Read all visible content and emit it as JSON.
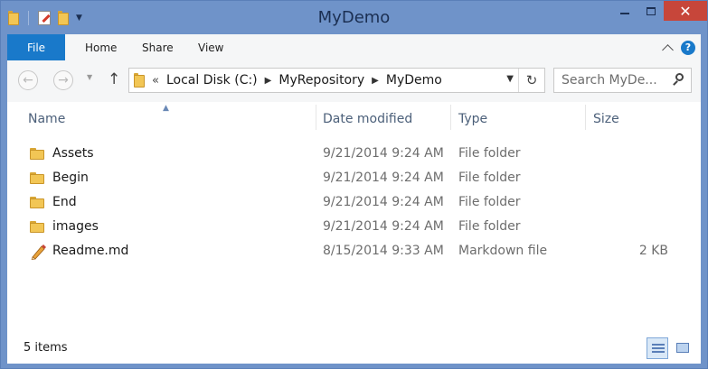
{
  "window": {
    "title": "MyDemo",
    "close_glyph": "✕",
    "accent": "#6f93c9",
    "close_color": "#c7463a"
  },
  "ribbon": {
    "tabs": [
      {
        "label": "File"
      },
      {
        "label": "Home"
      },
      {
        "label": "Share"
      },
      {
        "label": "View"
      }
    ],
    "help": "?",
    "file_color": "#1979ca"
  },
  "navigation": {
    "back_glyph": "←",
    "forward_glyph": "→",
    "up_glyph": "↑",
    "breadcrumb_prefix": "«",
    "path": [
      "Local Disk (C:)",
      "MyRepository",
      "MyDemo"
    ],
    "refresh_glyph": "↻",
    "search_placeholder": "Search MyDe..."
  },
  "file_list": {
    "columns": [
      {
        "label": "Name"
      },
      {
        "label": "Date modified"
      },
      {
        "label": "Type"
      },
      {
        "label": "Size"
      }
    ],
    "rows": [
      {
        "name": "Assets",
        "date": "9/21/2014 9:24 AM",
        "type": "File folder",
        "size": "",
        "icon": "folder-icon"
      },
      {
        "name": "Begin",
        "date": "9/21/2014 9:24 AM",
        "type": "File folder",
        "size": "",
        "icon": "folder-icon"
      },
      {
        "name": "End",
        "date": "9/21/2014 9:24 AM",
        "type": "File folder",
        "size": "",
        "icon": "folder-icon"
      },
      {
        "name": "images",
        "date": "9/21/2014 9:24 AM",
        "type": "File folder",
        "size": "",
        "icon": "folder-icon"
      },
      {
        "name": "Readme.md",
        "date": "8/15/2014 9:33 AM",
        "type": "Markdown file",
        "size": "2 KB",
        "icon": "pencil-file-icon"
      }
    ],
    "sort_column": "Name"
  },
  "status": {
    "item_count": "5 items",
    "view_mode": "details"
  }
}
